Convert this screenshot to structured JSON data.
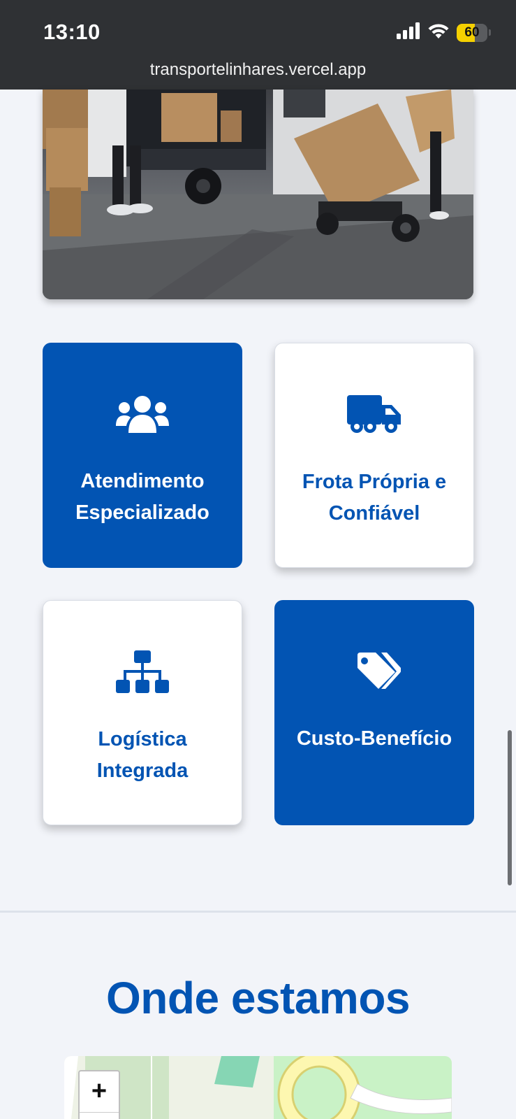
{
  "status_bar": {
    "time": "13:10",
    "battery": "60",
    "battery_level": 0.6,
    "icons": [
      "signal-icon",
      "wifi-icon",
      "battery-icon"
    ]
  },
  "browser": {
    "url": "transportelinhares.vercel.app"
  },
  "features": [
    {
      "label": "Atendimento Especializado",
      "icon": "users-icon",
      "style": "blue"
    },
    {
      "label": "Frota Própria e Confiável",
      "icon": "truck-icon",
      "style": "white"
    },
    {
      "label": "Logística Integrada",
      "icon": "sitemap-icon",
      "style": "white"
    },
    {
      "label": "Custo-Benefício",
      "icon": "tags-icon",
      "style": "blue"
    }
  ],
  "location": {
    "title": "Onde estamos",
    "zoom_in": "+"
  },
  "colors": {
    "primary": "#0254b3",
    "background": "#f2f4f9",
    "topbar": "#2f3134",
    "battery": "#f5d000"
  }
}
